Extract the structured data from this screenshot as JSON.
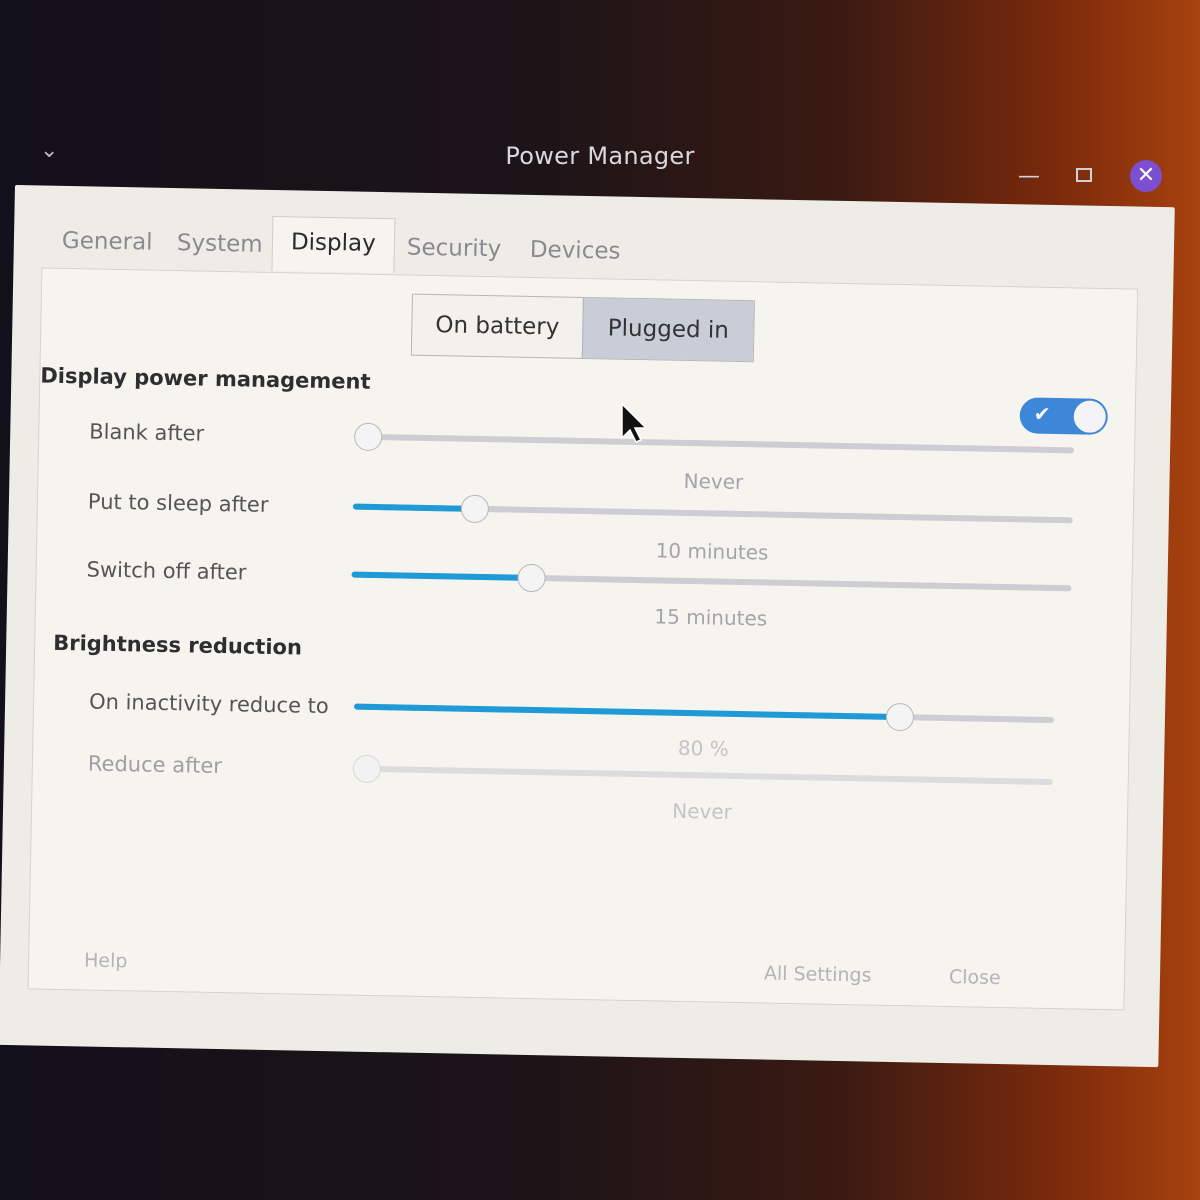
{
  "window": {
    "title": "Power Manager",
    "close_glyph": "✕"
  },
  "tabs": [
    {
      "label": "General"
    },
    {
      "label": "System"
    },
    {
      "label": "Display"
    },
    {
      "label": "Security"
    },
    {
      "label": "Devices"
    }
  ],
  "power_source": {
    "options": [
      "On battery",
      "Plugged in"
    ],
    "selected": "Plugged in"
  },
  "display_power_management": {
    "title": "Display power management",
    "enabled": true,
    "toggle_glyph": "✔",
    "rows": [
      {
        "label": "Blank after",
        "value": "Never",
        "fraction": 0.0
      },
      {
        "label": "Put to sleep after",
        "value": "10 minutes",
        "fraction": 0.17
      },
      {
        "label": "Switch off after",
        "value": "15 minutes",
        "fraction": 0.25
      }
    ]
  },
  "brightness_reduction": {
    "title": "Brightness reduction",
    "rows": [
      {
        "label": "On inactivity reduce to",
        "value": "80 %",
        "fraction": 0.78
      },
      {
        "label": "Reduce after",
        "value": "Never",
        "fraction": 0.0
      }
    ]
  },
  "footer": {
    "help": "Help",
    "all_settings": "All Settings",
    "close": "Close"
  },
  "colors": {
    "accent": "#1e9ad6",
    "toggle_on": "#3e86d8",
    "close_button": "#7b4fd0"
  },
  "icons": {
    "window_menu": "chevron-down-icon",
    "minimize": "minimize-icon",
    "maximize": "maximize-icon",
    "close": "close-icon",
    "cursor": "mouse-pointer-icon"
  }
}
